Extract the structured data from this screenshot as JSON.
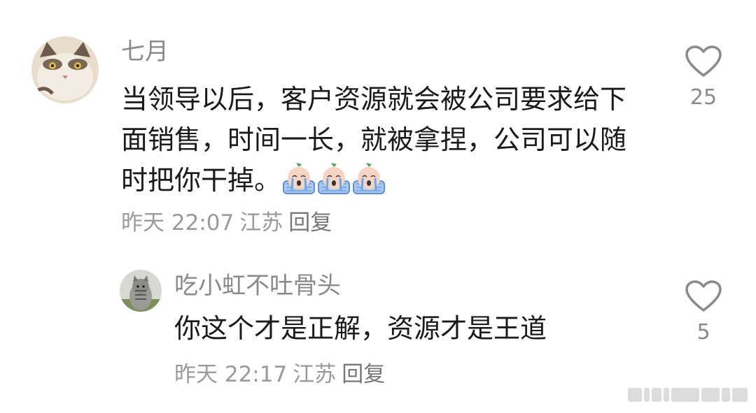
{
  "comments": [
    {
      "username": "七月",
      "text": "当领导以后，客户资源就会被公司要求给下面销售，时间一长，就被拿捏，公司可以随时把你干掉。",
      "emoji_icon": "crying-emoji-icon",
      "time": "昨天 22:07",
      "location": "江苏",
      "reply_label": "回复",
      "likes": "25"
    },
    {
      "username": "吃小虹不吐骨头",
      "text": "你这个才是正解，资源才是王道",
      "time": "昨天 22:17",
      "location": "江苏",
      "reply_label": "回复",
      "likes": "5"
    }
  ],
  "colors": {
    "text": "#1a1a1a",
    "muted": "#9a9a9a",
    "heart_outline": "#8a8a8a"
  }
}
